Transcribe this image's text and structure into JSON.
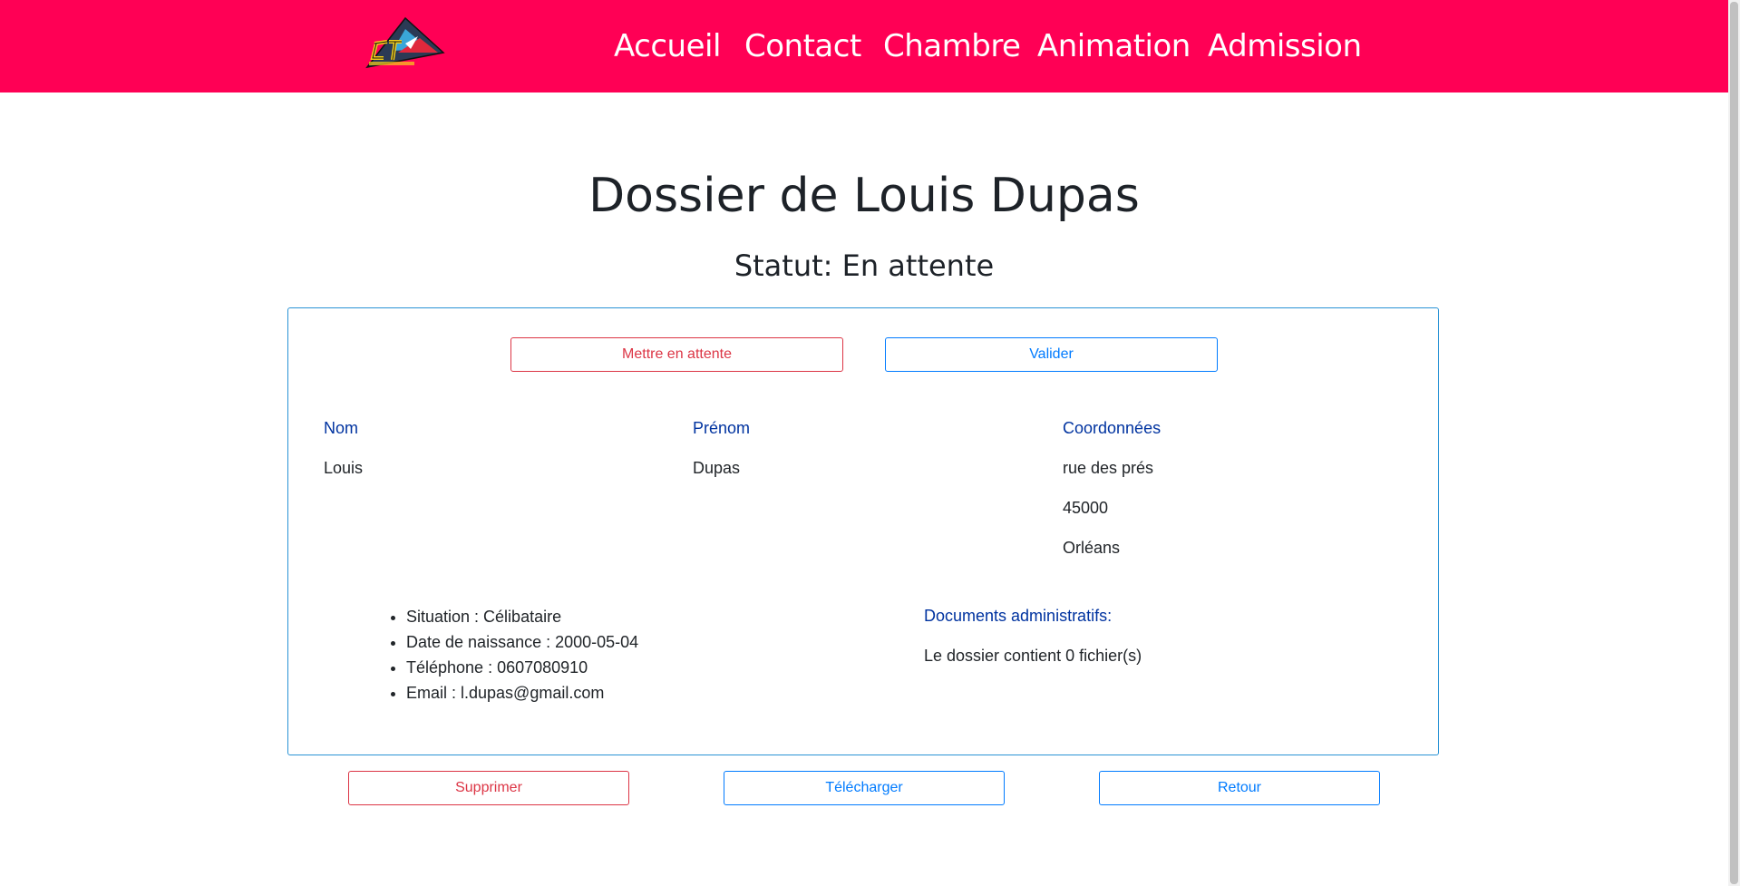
{
  "nav": {
    "logo_icon": "dt-triangle-logo-icon",
    "items": [
      {
        "label": "Accueil"
      },
      {
        "label": "Contact"
      },
      {
        "label": "Chambre"
      },
      {
        "label": "Animation"
      },
      {
        "label": "Admission"
      }
    ],
    "color": "#ff0055"
  },
  "page": {
    "title": "Dossier de Louis Dupas",
    "status": "Statut: En attente"
  },
  "actions_top": {
    "hold_label": "Mettre en attente",
    "validate_label": "Valider"
  },
  "columns": {
    "nom": {
      "header": "Nom",
      "value": "Louis"
    },
    "prenom": {
      "header": "Prénom",
      "value": "Dupas"
    },
    "coord": {
      "header": "Coordonnées",
      "lines": [
        "rue des prés",
        "45000",
        "Orléans"
      ]
    }
  },
  "details": [
    "Situation : Célibataire",
    "Date de naissance : 2000-05-04",
    "Téléphone : 0607080910",
    "Email : l.dupas@gmail.com"
  ],
  "documents": {
    "header": "Documents administratifs:",
    "summary": "Le dossier contient 0 fichier(s)"
  },
  "actions_bottom": {
    "delete_label": "Supprimer",
    "download_label": "Télécharger",
    "back_label": "Retour"
  }
}
